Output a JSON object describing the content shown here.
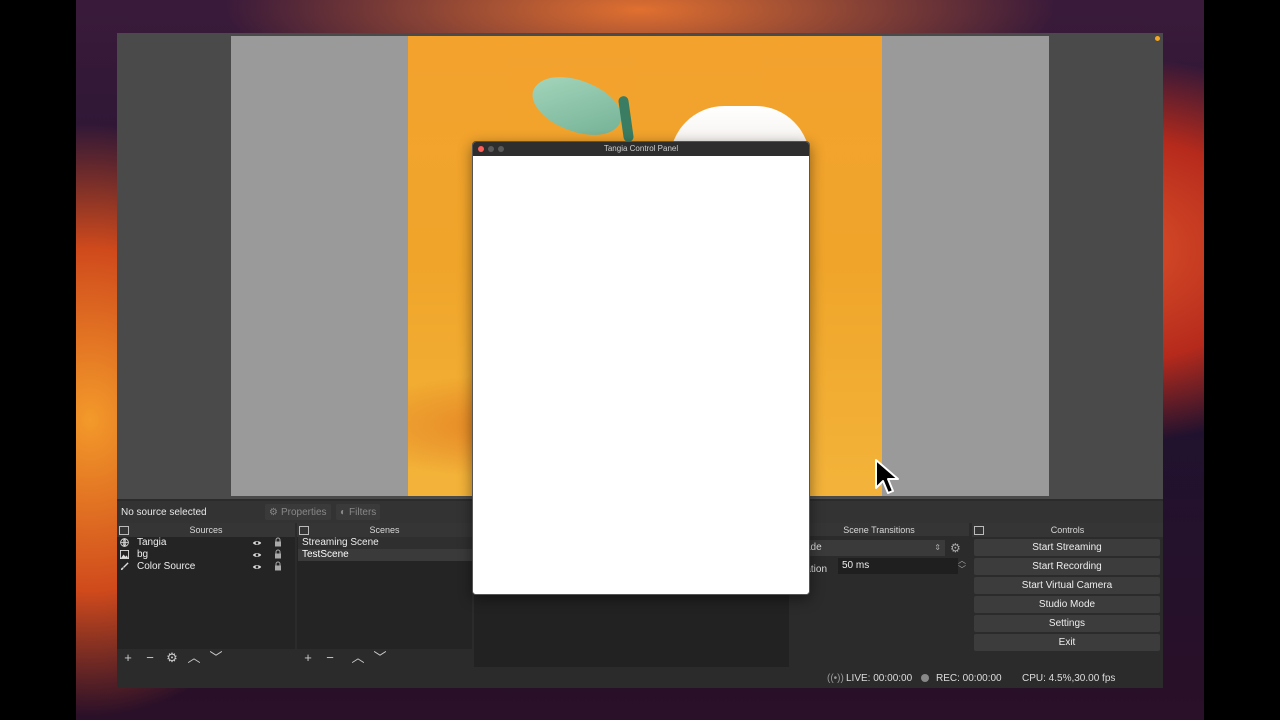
{
  "preview": {
    "status_text": "No source selected",
    "properties_label": "Properties",
    "filters_label": "Filters"
  },
  "sources": {
    "title": "Sources",
    "items": [
      {
        "label": "Tangia",
        "icon": "globe-icon"
      },
      {
        "label": "bg",
        "icon": "image-icon"
      },
      {
        "label": "Color Source",
        "icon": "paint-brush-icon"
      }
    ]
  },
  "scenes": {
    "title": "Scenes",
    "items": [
      {
        "label": "Streaming Scene",
        "selected": false
      },
      {
        "label": "TestScene",
        "selected": true
      }
    ]
  },
  "transitions": {
    "title": "Scene Transitions",
    "type_value": "ade",
    "duration_label": "ration",
    "duration_value": "50 ms"
  },
  "controls": {
    "title": "Controls",
    "buttons": [
      "Start Streaming",
      "Start Recording",
      "Start Virtual Camera",
      "Studio Mode",
      "Settings",
      "Exit"
    ]
  },
  "statusbar": {
    "live": "LIVE: 00:00:00",
    "rec": "REC: 00:00:00",
    "cpu": "CPU: 4.5%,30.00 fps"
  },
  "popup": {
    "title": "Tangia Control Panel"
  },
  "colors": {
    "panel_bg": "#2b2b2b",
    "orange_bg": "#f0a52a",
    "close_red": "#ff5f57"
  }
}
